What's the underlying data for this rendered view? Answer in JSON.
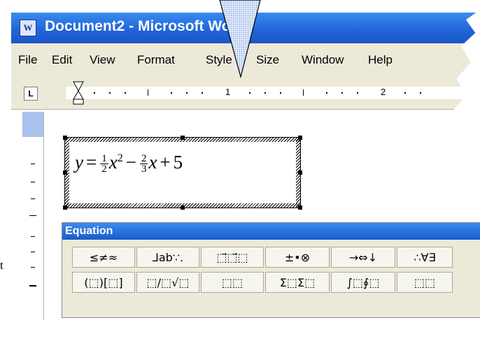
{
  "window": {
    "title": "Document2 - Microsoft Word",
    "icon": "word-doc-icon"
  },
  "menubar": {
    "items": [
      "File",
      "Edit",
      "View",
      "Format",
      "Style",
      "Size",
      "Window",
      "Help"
    ]
  },
  "ruler": {
    "tab_button": "L",
    "numbers": [
      "1",
      "2"
    ]
  },
  "equation_palette": {
    "title": "Equation",
    "row1": [
      "≤≠≈",
      "⅃ab∵.",
      "⬚⃗⬚⃗⬚",
      "±•⊗",
      "→⇔↓",
      "∴∀∃"
    ],
    "row2": [
      "(⬚)[⬚]",
      "⬚/⬚√⬚",
      "⬚⬚",
      "Σ⬚Σ⬚",
      "∫⬚∮⬚",
      "⬚⬚"
    ]
  },
  "formula": {
    "lhs": "y",
    "eq": "=",
    "f1_num": "1",
    "f1_den": "2",
    "x": "x",
    "exp": "2",
    "minus": "−",
    "f2_num": "2",
    "f2_den": "3",
    "x2": "x",
    "plus": "+",
    "const": "5"
  },
  "side_text": "t",
  "colors": {
    "titlebar": "#2165d8",
    "menubar": "#ece9d8",
    "vruler_highlight": "#a9c3ee"
  }
}
